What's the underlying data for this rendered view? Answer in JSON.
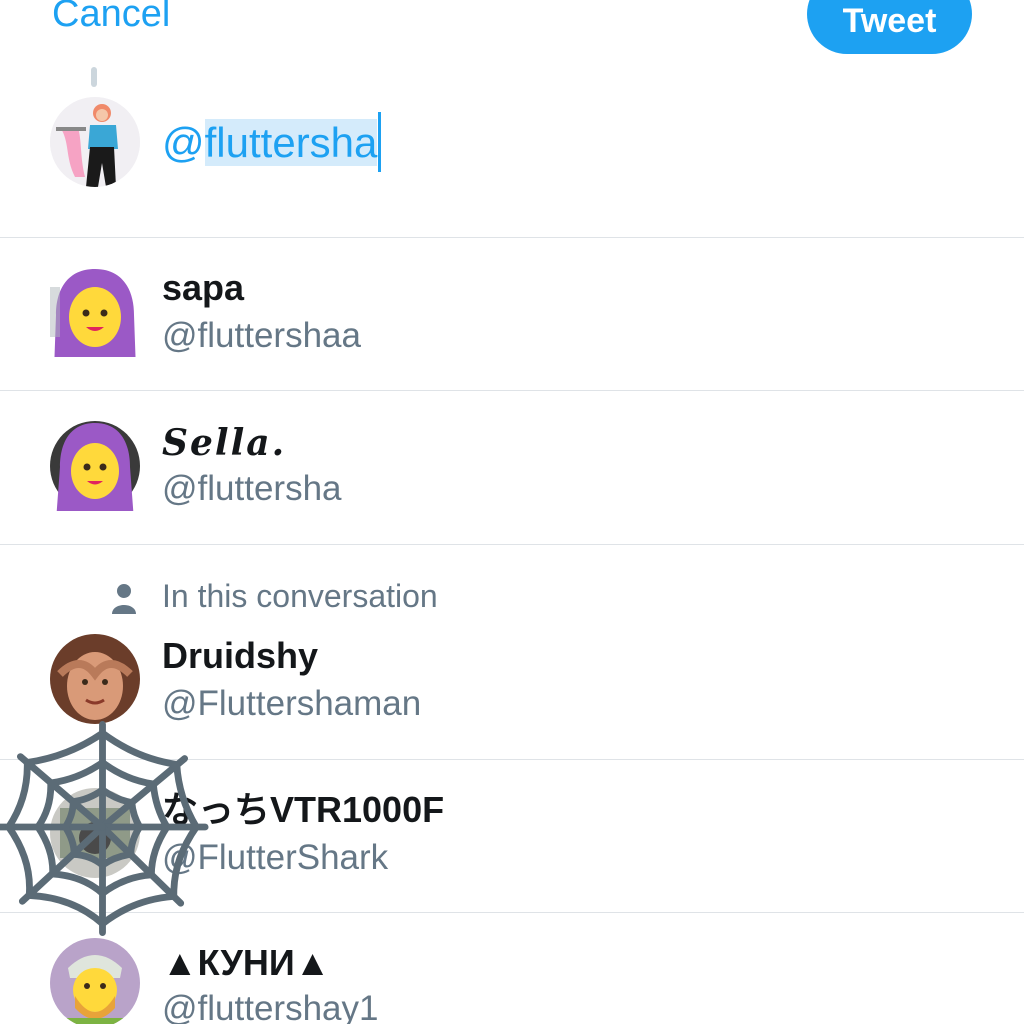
{
  "header": {
    "cancel_label": "Cancel",
    "tweet_label": "Tweet"
  },
  "composer": {
    "prefix": "@",
    "selected_text": "fluttersha"
  },
  "colors": {
    "accent": "#1DA1F2",
    "secondary_text": "#657786",
    "primary_text": "#14171a"
  },
  "suggestions": [
    {
      "name": "sapa",
      "handle": "@fluttershaa",
      "avatar": "hijab-emoji-avatar"
    },
    {
      "name": "𝑺𝒆𝒍𝒍𝒂.",
      "handle": "@fluttersha",
      "avatar": "hijab-emoji-avatar"
    }
  ],
  "conversation": {
    "label": "In this conversation",
    "icon": "person-icon",
    "users": [
      {
        "name": "Druidshy",
        "handle": "@Fluttershaman",
        "avatar": "photo-avatar"
      },
      {
        "name": "なっちVTR1000F",
        "handle": "@FlutterShark",
        "avatar": "photo-avatar"
      },
      {
        "name": "▲КУНИ▲",
        "handle": "@fluttershay1",
        "avatar": "turban-emoji-avatar"
      }
    ]
  },
  "overlay": {
    "icon": "spider-web-icon"
  }
}
